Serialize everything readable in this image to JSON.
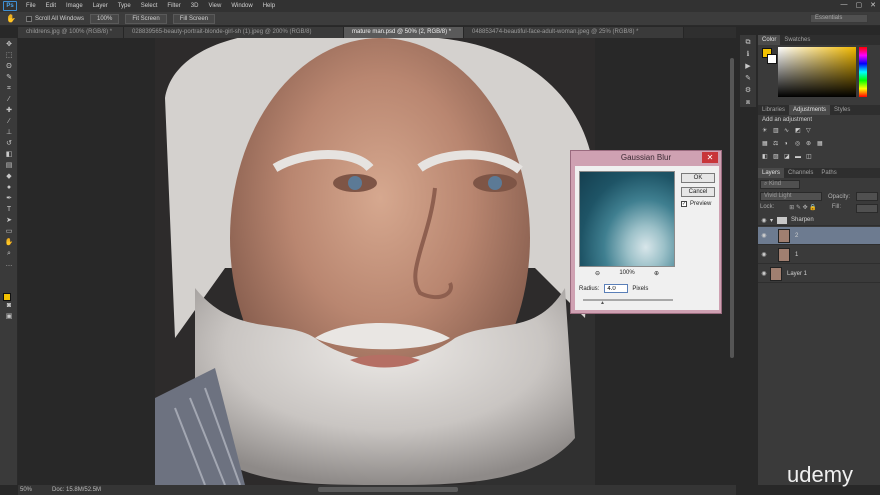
{
  "app": {
    "logo": "Ps"
  },
  "menu": [
    "File",
    "Edit",
    "Image",
    "Layer",
    "Type",
    "Select",
    "Filter",
    "3D",
    "View",
    "Window",
    "Help"
  ],
  "window_controls": [
    "—",
    "▢",
    "✕"
  ],
  "options_bar": {
    "scroll_all_label": "Scroll All Windows",
    "buttons": [
      "100%",
      "Fit Screen",
      "Fill Screen"
    ],
    "workspace": "Essentials"
  },
  "tabs": [
    {
      "label": "childrens.jpg @ 100% (RGB/8) *"
    },
    {
      "label": "028839565-beauty-portrait-blonde-girl-sh (1).jpeg @ 200% (RGB/8)"
    },
    {
      "label": "mature man.psd @ 50% (2, RGB/8) *",
      "active": true
    },
    {
      "label": "048853474-beautiful-face-adult-woman.jpeg @ 25% (RGB/8) *"
    }
  ],
  "dialog": {
    "title": "Gaussian Blur",
    "close": "✕",
    "ok_label": "OK",
    "cancel_label": "Cancel",
    "preview_label": "Preview",
    "preview_checked": "✓",
    "zoom_out": "⊖",
    "zoom_level": "100%",
    "zoom_in": "⊕",
    "radius_label": "Radius:",
    "radius_value": "4.0",
    "radius_unit": "Pixels"
  },
  "color_panel": {
    "tabs": [
      "Color",
      "Swatches"
    ],
    "foreground": "#f2c100",
    "background": "#ffffff"
  },
  "adjustments_panel": {
    "tabs": [
      "Libraries",
      "Adjustments",
      "Styles"
    ],
    "add_label": "Add an adjustment"
  },
  "layers_panel": {
    "tabs": [
      "Layers",
      "Channels",
      "Paths"
    ],
    "kind_filter": "Kind",
    "blend_mode": "Vivid Light",
    "opacity_label": "Opacity:",
    "lock_label": "Lock:",
    "fill_label": "Fill:",
    "layers": [
      {
        "name": "Sharpen",
        "type": "group"
      },
      {
        "name": "2",
        "selected": true
      },
      {
        "name": "1"
      },
      {
        "name": "Layer 1"
      }
    ]
  },
  "status": {
    "zoom": "50%",
    "doc": "Doc: 15.8M/52.5M"
  },
  "watermark": "udemy"
}
